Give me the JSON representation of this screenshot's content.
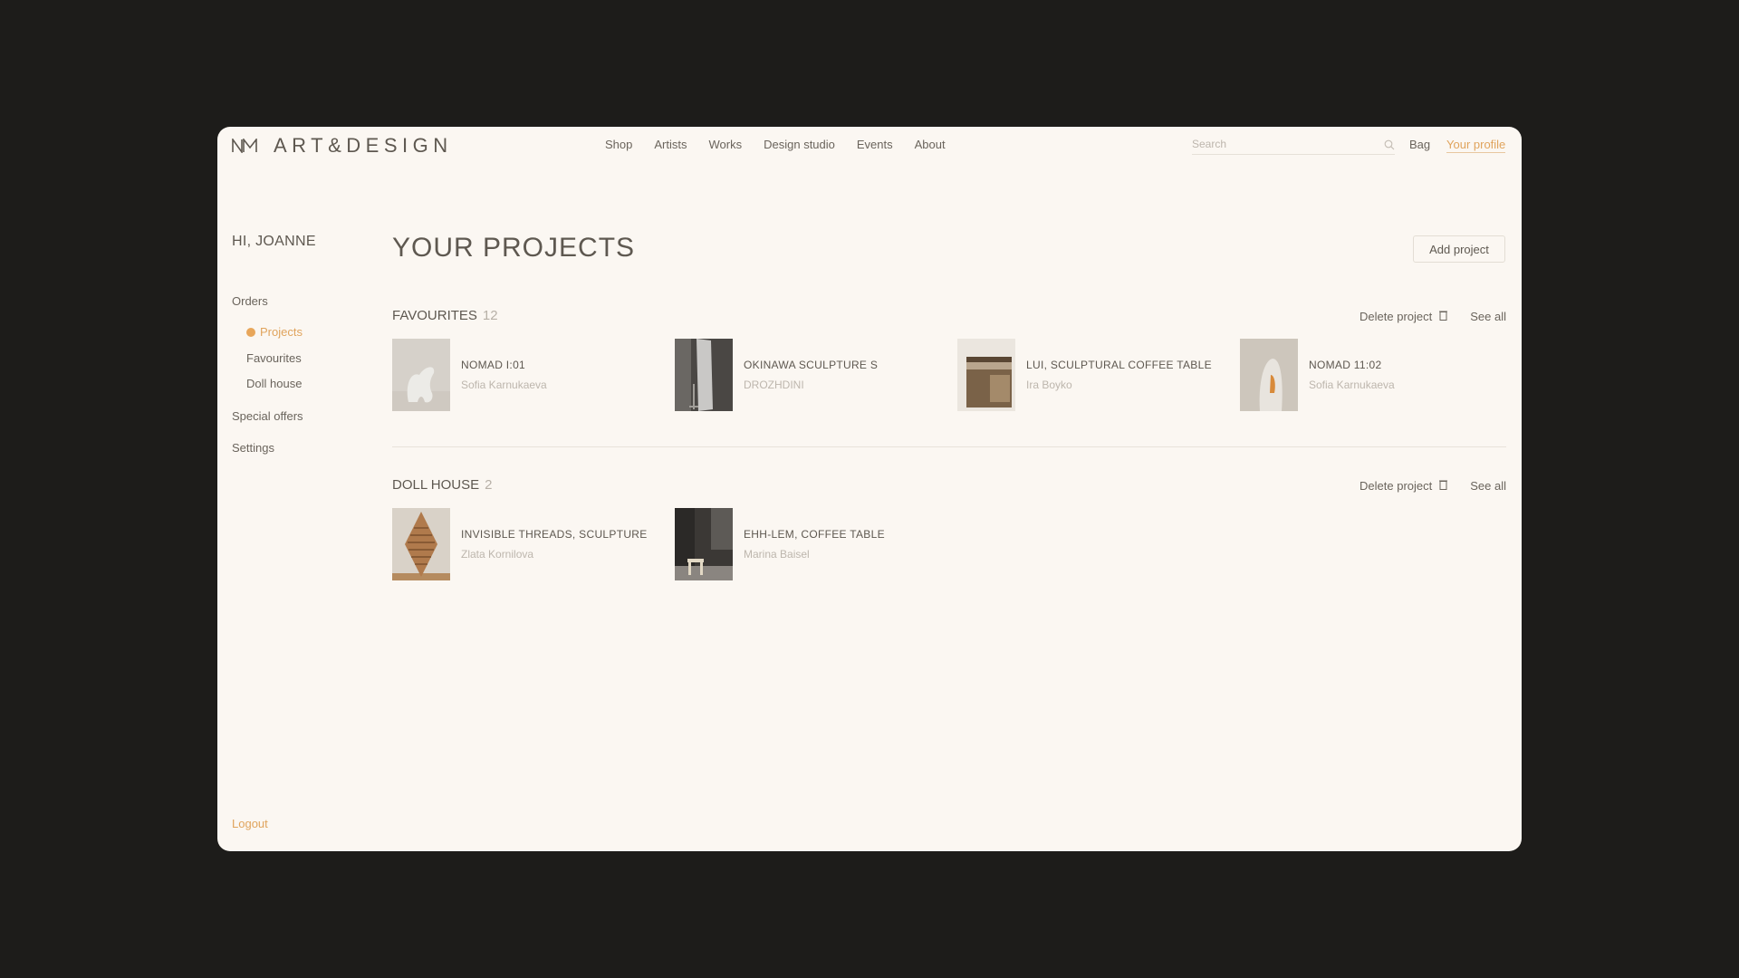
{
  "header": {
    "logo_text": "ART&DESIGN",
    "nav": [
      "Shop",
      "Artists",
      "Works",
      "Design studio",
      "Events",
      "About"
    ],
    "search_placeholder": "Search",
    "bag_label": "Bag",
    "profile_label": "Your profile"
  },
  "sidebar": {
    "greeting": "HI, JOANNE",
    "orders_label": "Orders",
    "projects_label": "Projects",
    "favourites_label": "Favourites",
    "dollhouse_label": "Doll house",
    "special_offers_label": "Special offers",
    "settings_label": "Settings",
    "logout_label": "Logout"
  },
  "main": {
    "title": "YOUR PROJECTS",
    "add_project_label": "Add project",
    "delete_label": "Delete project",
    "see_all_label": "See all",
    "sections": [
      {
        "title": "FAVOURITES",
        "count": "12",
        "items": [
          {
            "title": "NOMAD I:01",
            "author": "Sofia Karnukaeva"
          },
          {
            "title": "OKINAWA SCULPTURE S",
            "author": "DROZHDINI"
          },
          {
            "title": "LUI, SCULPTURAL COFFEE TABLE",
            "author": "Ira Boyko"
          },
          {
            "title": "NOMAD 11:02",
            "author": "Sofia Karnukaeva"
          }
        ]
      },
      {
        "title": "DOLL HOUSE",
        "count": "2",
        "items": [
          {
            "title": "INVISIBLE THREADS, SCULPTURE",
            "author": "Zlata Kornilova"
          },
          {
            "title": "EHH-LEM, COFFEE TABLE",
            "author": "Marina Baisel"
          }
        ]
      }
    ]
  },
  "colors": {
    "page_background": "#1d1c1a",
    "panel_background": "#fbf7f2",
    "accent": "#e0a45d",
    "text": "#6a645c",
    "muted_text": "#bdb6ad"
  }
}
